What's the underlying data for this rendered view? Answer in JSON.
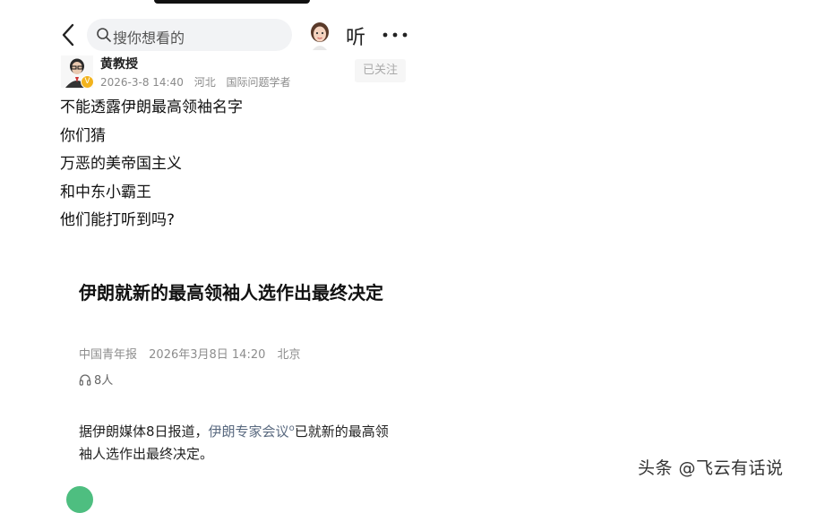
{
  "search": {
    "placeholder": "搜你想看的"
  },
  "toolbar": {
    "listen_label": "听"
  },
  "author": {
    "name": "黄教授",
    "date": "2026-3-8 14:40",
    "location": "河北",
    "tagline": "国际问题学者",
    "follow_label": "已关注"
  },
  "post": {
    "lines": [
      "不能透露伊朗最高领袖名字",
      "你们猜",
      "万恶的美帝国主义",
      "和中东小霸王",
      "他们能打听到吗?"
    ]
  },
  "article": {
    "title": "伊朗就新的最高领袖人选作出最终决定",
    "source": "中国青年报",
    "datetime": "2026年3月8日 14:20",
    "location": "北京",
    "listeners": "8人",
    "body_prefix": "据伊朗媒体8日报道，",
    "body_link": "伊朗专家会议",
    "body_suffix": "已就新的最高领袖人选作出最终决定。"
  },
  "watermark": "头条 @飞云有话说"
}
